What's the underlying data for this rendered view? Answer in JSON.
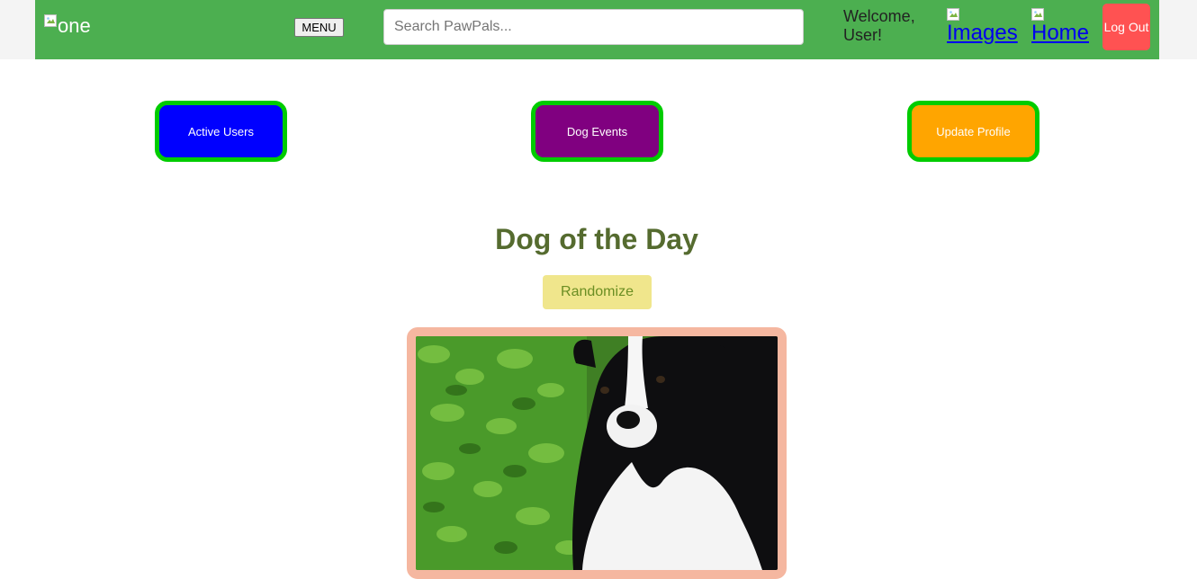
{
  "header": {
    "logo_alt": "one",
    "menu_label": "MENU",
    "search_placeholder": "Search PawPals...",
    "welcome_text": "Welcome, User!",
    "nav_links": [
      {
        "label": "Images"
      },
      {
        "label": "Home"
      }
    ],
    "logout_label": "Log Out",
    "colors": {
      "bar": "#4caf50",
      "logout": "#ff5252"
    }
  },
  "quick_actions": [
    {
      "label": "Active Users",
      "color": "#0000ff"
    },
    {
      "label": "Dog Events",
      "color": "#800080"
    },
    {
      "label": "Update Profile",
      "color": "#ffa500"
    }
  ],
  "dog_of_day": {
    "title": "Dog of the Day",
    "randomize_label": "Randomize",
    "photo_icon": "dog-photo"
  }
}
